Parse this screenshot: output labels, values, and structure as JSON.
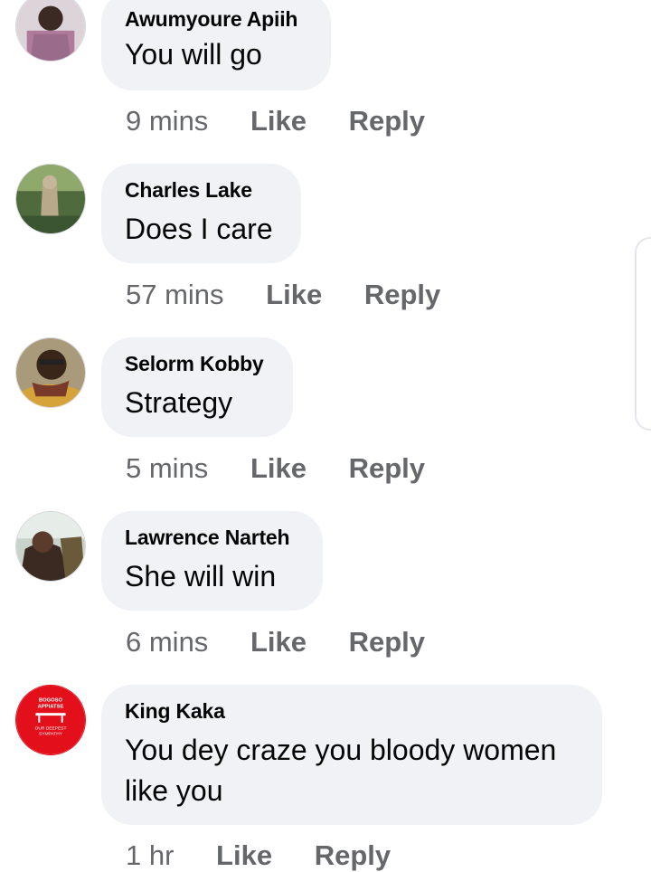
{
  "comments": [
    {
      "author": "Awumyoure Apiih",
      "text": "You will go",
      "time": "9 mins",
      "like": "Like",
      "reply": "Reply",
      "avatar": "person-photo-avatar"
    },
    {
      "author": "Charles Lake",
      "text": "Does I care",
      "time": "57 mins",
      "like": "Like",
      "reply": "Reply",
      "avatar": "person-photo-avatar"
    },
    {
      "author": "Selorm Kobby",
      "text": "Strategy",
      "time": "5 mins",
      "like": "Like",
      "reply": "Reply",
      "avatar": "person-photo-avatar"
    },
    {
      "author": "Lawrence Narteh",
      "text": "She will win",
      "time": "6 mins",
      "like": "Like",
      "reply": "Reply",
      "avatar": "person-photo-avatar"
    },
    {
      "author": "King Kaka",
      "text_lines": [
        "You dey craze you bloody women",
        "like you"
      ],
      "time": "1 hr",
      "like": "Like",
      "reply": "Reply",
      "avatar": "red-banner-avatar",
      "avatar_text": {
        "line1": "BOGOSO",
        "line2": "APPIATSE",
        "line3": "OUR DEEPEST",
        "line4": "SYMPATHY"
      }
    }
  ],
  "colors": {
    "bubble": "#f0f2f5",
    "meta": "#65676b",
    "text": "#050505",
    "avatar_red": "#e3101b"
  }
}
